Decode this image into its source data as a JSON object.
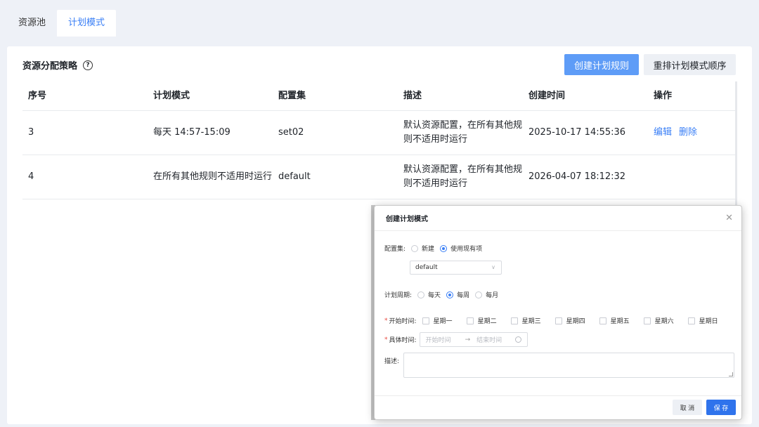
{
  "tabs": [
    {
      "label": "资源池"
    },
    {
      "label": "计划模式"
    }
  ],
  "card": {
    "title": "资源分配策略",
    "help_icon": "help-circle-icon",
    "create_rule_label": "创建计划规则",
    "reorder_label": "重排计划模式顺序"
  },
  "table": {
    "headers": [
      "序号",
      "计划模式",
      "配置集",
      "描述",
      "创建时间",
      "操作"
    ],
    "rows": [
      {
        "index": "3",
        "mode": "每天 14:57-15:09",
        "config": "set02",
        "desc": "默认资源配置，在所有其他规则不适用时运行",
        "created": "2025-10-17 14:55:36",
        "actions": [
          "编辑",
          "删除"
        ]
      },
      {
        "index": "4",
        "mode": "在所有其他规则不适用时运行",
        "config": "default",
        "desc": "默认资源配置，在所有其他规则不适用时运行",
        "created": "2026-04-07 18:12:32",
        "actions": []
      }
    ]
  },
  "modal": {
    "title": "创建计划模式",
    "config_label": "配置集:",
    "config_options": [
      "新建",
      "使用现有项"
    ],
    "config_selected": "使用现有项",
    "select_value": "default",
    "period_label": "计划周期:",
    "period_options": [
      "每天",
      "每周",
      "每月"
    ],
    "period_selected": "每周",
    "start_label": "开始时间:",
    "weekdays": [
      "星期一",
      "星期二",
      "星期三",
      "星期四",
      "星期五",
      "星期六",
      "星期日"
    ],
    "time_label": "具体时间:",
    "time_start_placeholder": "开始时间",
    "time_end_placeholder": "结束时间",
    "desc_label": "描述:",
    "cancel_label": "取 消",
    "save_label": "保 存"
  },
  "colors": {
    "accent": "#3a7ff6",
    "primary_button": "#5e9cf7",
    "save_button": "#2f73ec",
    "required": "#e8453c"
  }
}
